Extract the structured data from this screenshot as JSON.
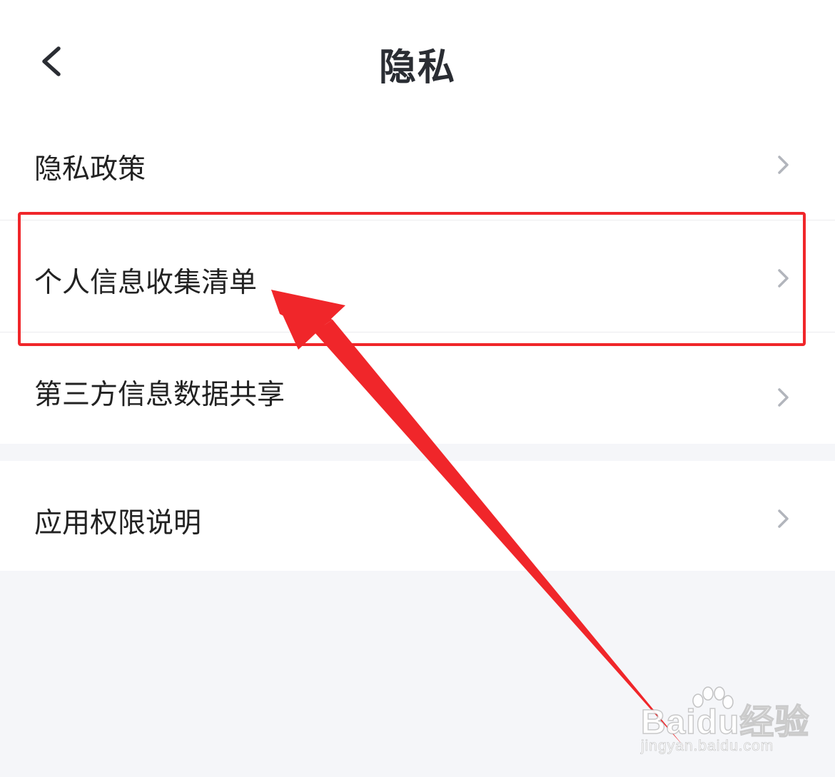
{
  "header": {
    "title": "隐私",
    "back_icon": "chevron-left-icon"
  },
  "menu": {
    "items": [
      {
        "label": "隐私政策",
        "icon": "chevron-right-icon"
      },
      {
        "label": "个人信息收集清单",
        "icon": "chevron-right-icon",
        "highlighted": true
      },
      {
        "label": "第三方信息数据共享",
        "icon": "chevron-right-icon"
      },
      {
        "label": "应用权限说明",
        "icon": "chevron-right-icon"
      }
    ]
  },
  "annotation": {
    "highlight_color": "#f0262a",
    "arrow_color": "#f0262a"
  },
  "watermark": {
    "brand": "Baidu经验",
    "url": "jingyan.baidu.com"
  },
  "colors": {
    "background": "#f5f6f9",
    "card": "#ffffff",
    "title_text": "#2a2d33",
    "chevron": "#b2b5bc"
  }
}
